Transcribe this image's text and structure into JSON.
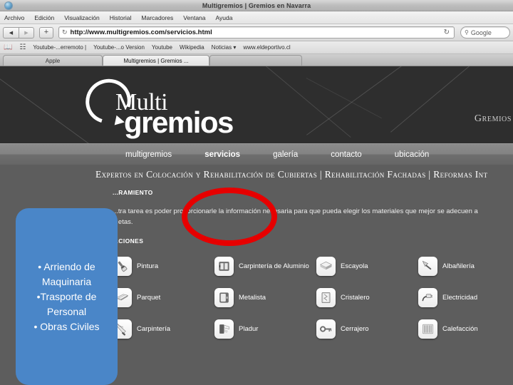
{
  "window": {
    "title": "Multigremios | Gremios en Navarra",
    "apple_logo": "apple-logo"
  },
  "menubar": {
    "items": [
      "Archivo",
      "Edición",
      "Visualización",
      "Historial",
      "Marcadores",
      "Ventana",
      "Ayuda"
    ]
  },
  "toolbar": {
    "back_label": "◀",
    "forward_label": "▶",
    "new_tab_label": "+",
    "reload_left_glyph": "↻",
    "url": "http://www.multigremios.com/servicios.html",
    "reload_label": "↻",
    "search_glyph": "🔍",
    "search_placeholder": "Google"
  },
  "bookmarks": {
    "book_icon": "book-icon",
    "grid_icon": "grid-icon",
    "items": [
      "Youtube-...erremoto |",
      "Youtube-...o Version",
      "Youtube",
      "Wikipedia",
      "Noticias ▾",
      "www.eldeportivo.cl"
    ]
  },
  "tabs": [
    {
      "label": "Apple",
      "active": false
    },
    {
      "label": "Multigremios | Gremios ...",
      "active": true
    }
  ],
  "site": {
    "logo_top": "Multi",
    "logo_bottom": "gremios",
    "header_right": "Gremios",
    "nav": [
      {
        "label": "multigremios",
        "active": false
      },
      {
        "label": "servicios",
        "active": true
      },
      {
        "label": "galería",
        "active": false
      },
      {
        "label": "contacto",
        "active": false
      },
      {
        "label": "ubicación",
        "active": false
      }
    ],
    "tagline": "Expertos en Colocación y Rehabilitación de Cubiertas | Rehabilitación Fachadas | Reformas Int",
    "section_title": "...RAMIENTO",
    "section_body": "...tra tarea es poder proporcionarle la información necesaria para que pueda elegir los materiales que mejor se adecuen a",
    "section_body2": "...etas.",
    "section_title2": "...CIONES",
    "services": [
      {
        "label": "Pintura",
        "icon": "paint-brush-icon"
      },
      {
        "label": "Carpintería de Aluminio",
        "icon": "aluminium-window-icon"
      },
      {
        "label": "Escayola",
        "icon": "plaster-board-icon"
      },
      {
        "label": "Albañilería",
        "icon": "trowel-icon"
      },
      {
        "label": "",
        "icon": "tool-icon"
      },
      {
        "label": "Parquet",
        "icon": "parquet-floor-icon"
      },
      {
        "label": "Metalista",
        "icon": "metal-door-icon"
      },
      {
        "label": "Cristalero",
        "icon": "glass-pane-icon"
      },
      {
        "label": "Electricidad",
        "icon": "plug-icon"
      },
      {
        "label": "",
        "icon": "door-icon"
      },
      {
        "label": "Carpintería",
        "icon": "handsaw-icon"
      },
      {
        "label": "Pladur",
        "icon": "plasterboard-icon"
      },
      {
        "label": "Cerrajero",
        "icon": "key-icon"
      },
      {
        "label": "Calefacción",
        "icon": "radiator-icon"
      },
      {
        "label": "",
        "icon": "roof-icon"
      }
    ]
  },
  "annotations": {
    "highlight_color": "#e60000",
    "panel_color": "#4a86c8",
    "panel_lines": [
      "• Arriendo de",
      "Maquinaria",
      "•Trasporte de",
      "Personal",
      "• Obras Civiles"
    ]
  }
}
